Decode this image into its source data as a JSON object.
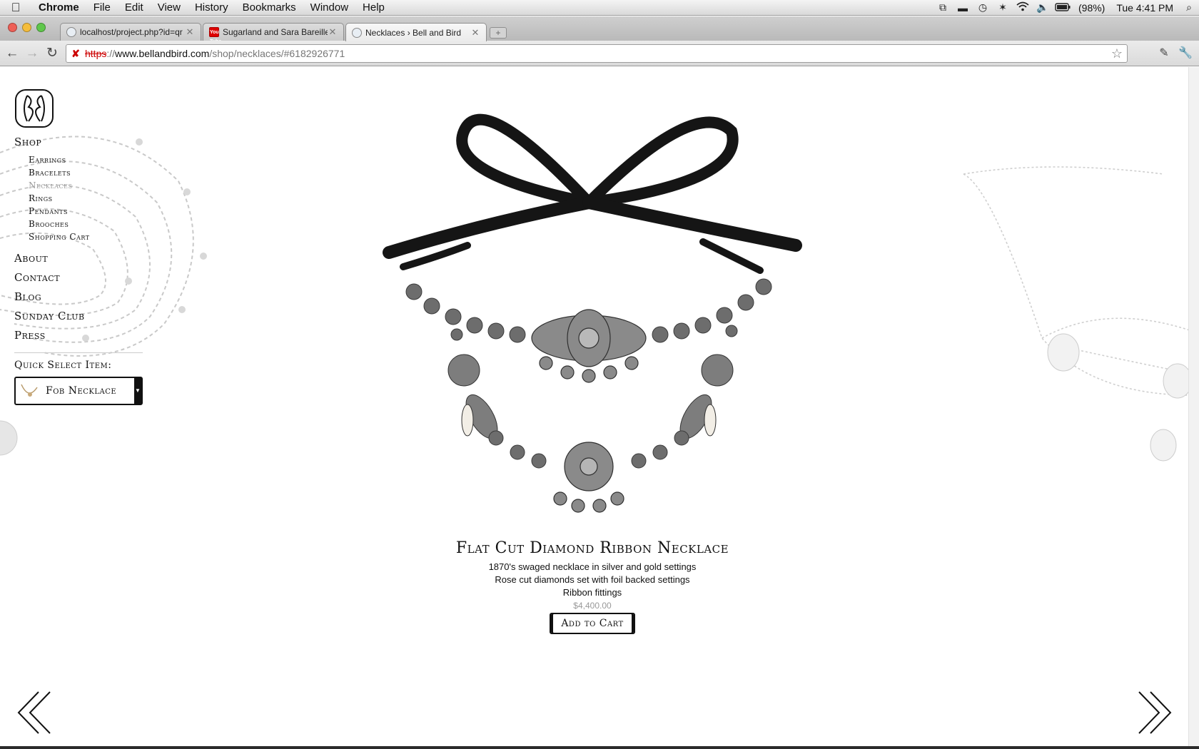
{
  "menubar": {
    "apple_icon": "apple-icon",
    "items": [
      "Chrome",
      "File",
      "Edit",
      "View",
      "History",
      "Bookmarks",
      "Window",
      "Help"
    ],
    "battery": "(98%)",
    "clock": "Tue 4:41 PM"
  },
  "tabs": [
    {
      "title": "localhost/project.php?id=qr",
      "favicon": "globe-icon"
    },
    {
      "title": "Sugarland and Sara Bareilles",
      "favicon": "youtube-icon",
      "favicon_text": "You Tube"
    },
    {
      "title": "Necklaces › Bell and Bird",
      "favicon": "globe-icon",
      "active": true
    }
  ],
  "new_tab_label": "+",
  "address": {
    "protocol": "https",
    "separator": "://",
    "host": "www.bellandbird.com",
    "path": "/shop/necklaces/#6182926771"
  },
  "sidebar": {
    "shop_label": "Shop",
    "sub_items": [
      "Earrings",
      "Bracelets",
      "Necklaces",
      "Rings",
      "Pendants",
      "Brooches",
      "Shopping Cart"
    ],
    "current_sub": "Necklaces",
    "top_items": [
      "About",
      "Contact",
      "Blog",
      "Sunday Club",
      "Press"
    ],
    "quick_select_label": "Quick Select Item:",
    "quick_select_value": "Fob Necklace"
  },
  "product": {
    "title": "Flat Cut Diamond Ribbon Necklace",
    "description": [
      "1870's swaged necklace in silver and gold settings",
      "Rose cut diamonds set with foil backed settings",
      "Ribbon fittings"
    ],
    "price": "$4,400.00",
    "add_to_cart_label": "Add to Cart"
  },
  "colors": {
    "text": "#111111",
    "muted": "#999999",
    "ribbon": "#151515",
    "silver": "#8a8a8a"
  }
}
